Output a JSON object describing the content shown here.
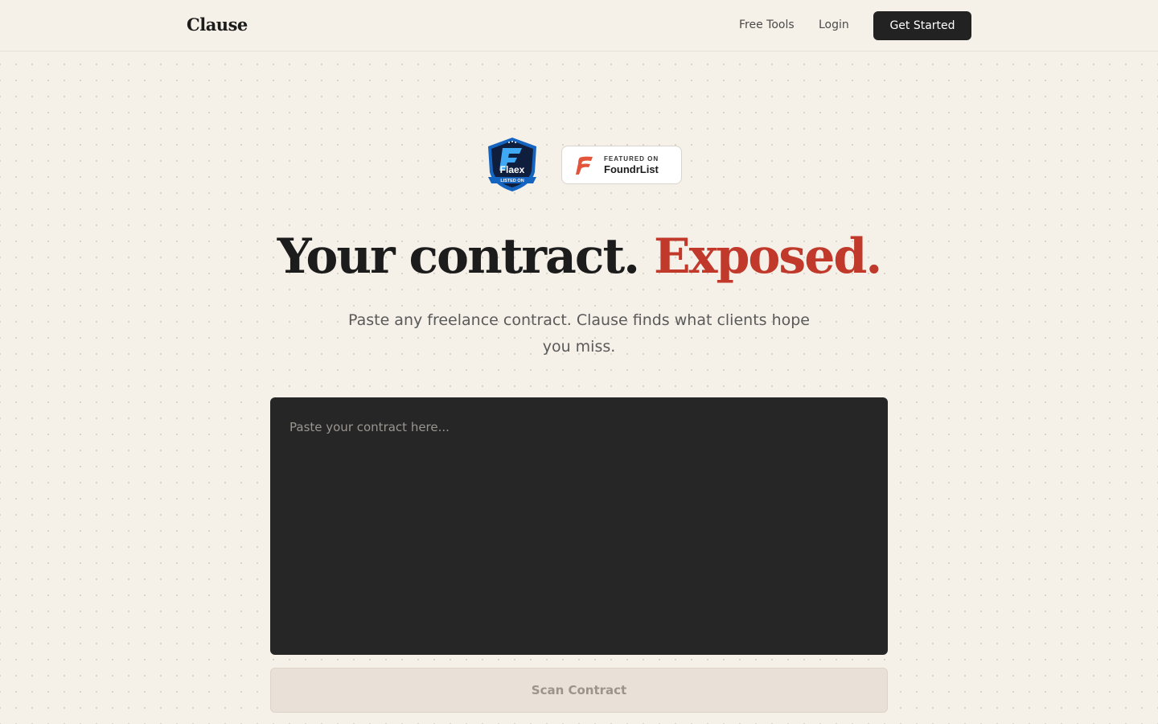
{
  "nav": {
    "logo": "Clause",
    "free_tools": "Free Tools",
    "login": "Login",
    "cta": "Get Started"
  },
  "badges": {
    "flaex": {
      "name": "Flaex",
      "caption": "LISTED ON"
    },
    "foundrlist": {
      "caption": "FEATURED ON",
      "name": "FoundrList"
    }
  },
  "hero": {
    "title_main": "Your contract.",
    "title_accent": "Exposed.",
    "subtitle": "Paste any freelance contract. Clause finds what clients hope you miss."
  },
  "contract": {
    "placeholder": "Paste your contract here...",
    "value": ""
  },
  "scan": {
    "label": "Scan Contract"
  },
  "colors": {
    "background": "#f5f0e8",
    "accent": "#c0392b",
    "dark": "#222222",
    "input_bg": "#262626",
    "scan_bg": "#e9e1d7"
  }
}
